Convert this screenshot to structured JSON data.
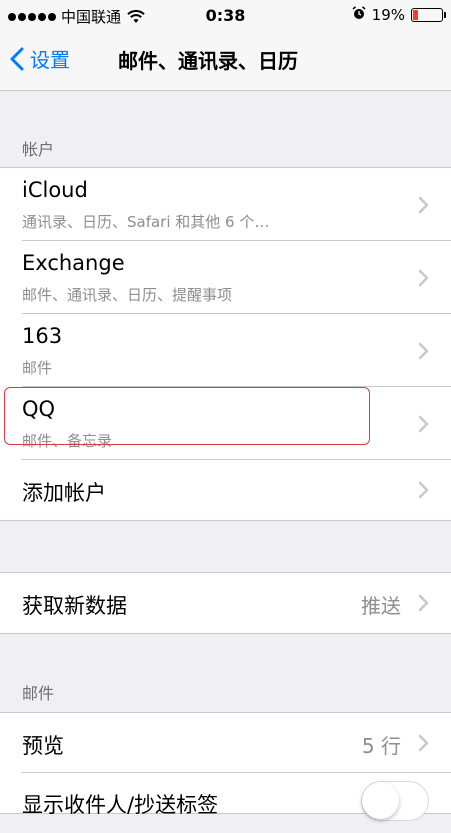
{
  "status_bar": {
    "carrier": "中国联通",
    "time": "0:38",
    "battery_percent": "19%",
    "battery_level": 0.19,
    "battery_color": "#ff3b30"
  },
  "nav": {
    "back_label": "设置",
    "title": "邮件、通讯录、日历",
    "accent_color": "#007aff"
  },
  "accounts_section": {
    "header": "帐户",
    "accounts": [
      {
        "name": "iCloud",
        "detail": "通讯录、日历、Safari 和其他 6 个…"
      },
      {
        "name": "Exchange",
        "detail": "邮件、通讯录、日历、提醒事项"
      },
      {
        "name": "163",
        "detail": "邮件"
      },
      {
        "name": "QQ",
        "detail": "邮件、备忘录"
      }
    ],
    "add_account": "添加帐户"
  },
  "fetch": {
    "label": "获取新数据",
    "value": "推送"
  },
  "mail_section": {
    "header": "邮件",
    "preview_label": "预览",
    "preview_value": "5 行",
    "show_to_cc_label": "显示收件人/抄送标签",
    "show_to_cc_on": false
  }
}
